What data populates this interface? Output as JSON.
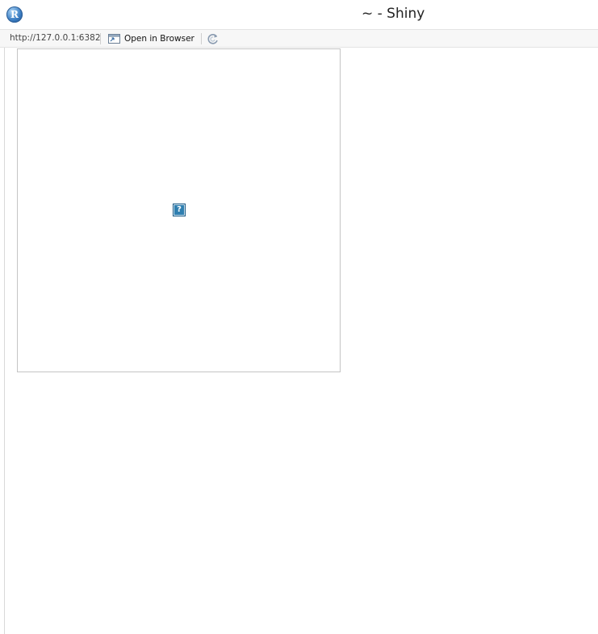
{
  "window": {
    "title": "~ - Shiny",
    "app_icon": "r-logo-icon",
    "app_icon_letter": "R"
  },
  "toolbar": {
    "url": "http://127.0.0.1:6382",
    "open_in_browser_label": "Open in Browser",
    "open_in_browser_icon": "browser-window-icon",
    "refresh_icon": "refresh-icon"
  },
  "content": {
    "plot_placeholder_icon": "broken-image-icon",
    "plot_placeholder_glyph": "?"
  },
  "colors": {
    "accent_blue": "#2f7fb0",
    "plot_border": "#c4c4c4",
    "toolbar_bg": "#f7f7f7"
  }
}
